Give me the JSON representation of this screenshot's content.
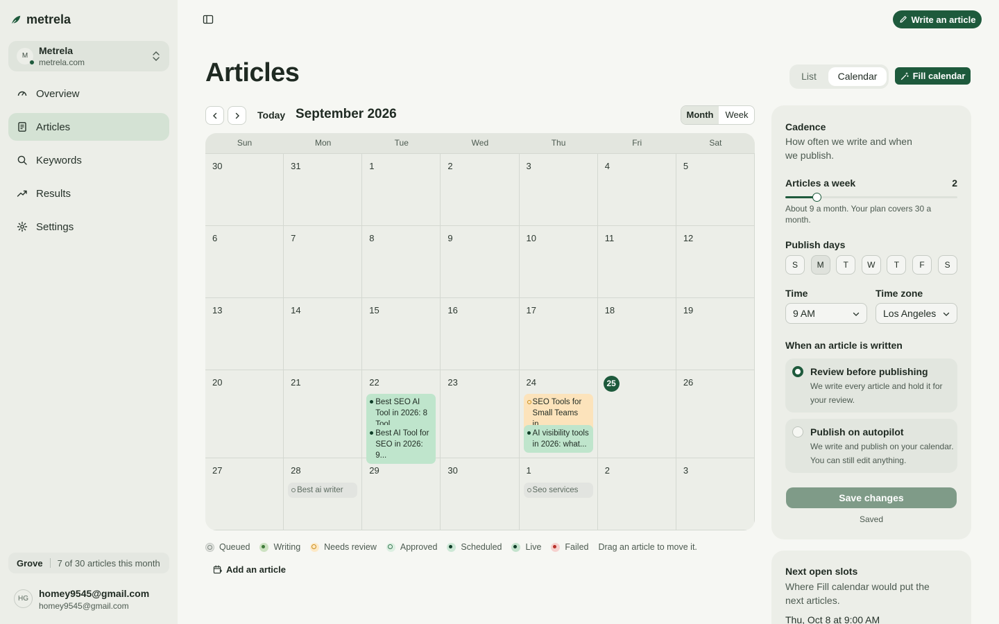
{
  "sidebar": {
    "brand": "metrela",
    "workspace": {
      "initial": "M",
      "name": "Metrela",
      "domain": "metrela.com"
    },
    "nav": [
      {
        "label": "Overview",
        "icon": "gauge-icon"
      },
      {
        "label": "Articles",
        "icon": "document-icon",
        "active": true
      },
      {
        "label": "Keywords",
        "icon": "search-icon"
      },
      {
        "label": "Results",
        "icon": "trending-up-icon"
      },
      {
        "label": "Settings",
        "icon": "gear-icon"
      }
    ],
    "plan": {
      "name": "Grove",
      "usage": "7 of 30 articles this month"
    },
    "user": {
      "initials": "HG",
      "name": "homey9545@gmail.com",
      "email": "homey9545@gmail.com"
    }
  },
  "header": {
    "write_button": "Write an article",
    "title": "Articles",
    "view_tabs": {
      "list": "List",
      "calendar": "Calendar"
    },
    "fill_button": "Fill calendar"
  },
  "calendar": {
    "today_label": "Today",
    "month_label": "September 2026",
    "modes": {
      "month": "Month",
      "week": "Week"
    },
    "weekdays": [
      "Sun",
      "Mon",
      "Tue",
      "Wed",
      "Thu",
      "Fri",
      "Sat"
    ],
    "weeks": [
      [
        "30",
        "31",
        "1",
        "2",
        "3",
        "4",
        "5"
      ],
      [
        "6",
        "7",
        "8",
        "9",
        "10",
        "11",
        "12"
      ],
      [
        "13",
        "14",
        "15",
        "16",
        "17",
        "18",
        "19"
      ],
      [
        "20",
        "21",
        "22",
        "23",
        "24",
        "25",
        "26"
      ],
      [
        "27",
        "28",
        "29",
        "30",
        "1",
        "2",
        "3"
      ]
    ],
    "today": "25",
    "events": [
      {
        "day": "22",
        "status": "scheduled",
        "title": "Best SEO AI Tool in 2026: 8 Tool..."
      },
      {
        "day": "22",
        "status": "scheduled",
        "title": "Best AI Tool for SEO in 2026: 9..."
      },
      {
        "day": "24",
        "status": "needs-review",
        "title": "SEO Tools for Small Teams in..."
      },
      {
        "day": "24",
        "status": "scheduled",
        "title": "AI visibility tools in 2026: what..."
      },
      {
        "day": "28",
        "status": "queued",
        "title": "Best ai writer"
      },
      {
        "day": "1",
        "status": "queued",
        "title": "Seo services"
      }
    ],
    "legend": [
      "Queued",
      "Writing",
      "Needs review",
      "Approved",
      "Scheduled",
      "Live",
      "Failed"
    ],
    "drag_hint": "Drag an article to move it.",
    "add_article": "Add an article"
  },
  "cadence": {
    "title": "Cadence",
    "subtitle": "How often we write and when we publish.",
    "articles_week_label": "Articles a week",
    "articles_week_value": "2",
    "slider_fraction": 0.18,
    "note": "About 9 a month. Your plan covers 30 a month.",
    "publish_days_label": "Publish days",
    "days": [
      {
        "label": "S",
        "on": false
      },
      {
        "label": "M",
        "on": true
      },
      {
        "label": "T",
        "on": false
      },
      {
        "label": "W",
        "on": false
      },
      {
        "label": "T",
        "on": false
      },
      {
        "label": "F",
        "on": false
      },
      {
        "label": "S",
        "on": false
      }
    ],
    "time_label": "Time",
    "time_value": "9 AM",
    "tz_label": "Time zone",
    "tz_value": "Los Angeles",
    "written_label": "When an article is written",
    "options": [
      {
        "title": "Review before publishing",
        "desc": "We write every article and hold it for your review.",
        "selected": true
      },
      {
        "title": "Publish on autopilot",
        "desc": "We write and publish on your calendar. You can still edit anything.",
        "selected": false
      }
    ],
    "save_button": "Save changes",
    "saved_text": "Saved"
  },
  "slots": {
    "title": "Next open slots",
    "subtitle": "Where Fill calendar would put the next articles.",
    "first_slot": "Thu, Oct 8 at 9:00 AM"
  },
  "colors": {
    "accent": "#1e5a3c",
    "scheduled_chip": "#bfe5cc",
    "review_chip": "#fce3bb",
    "sidebar_bg": "#eceee8"
  }
}
